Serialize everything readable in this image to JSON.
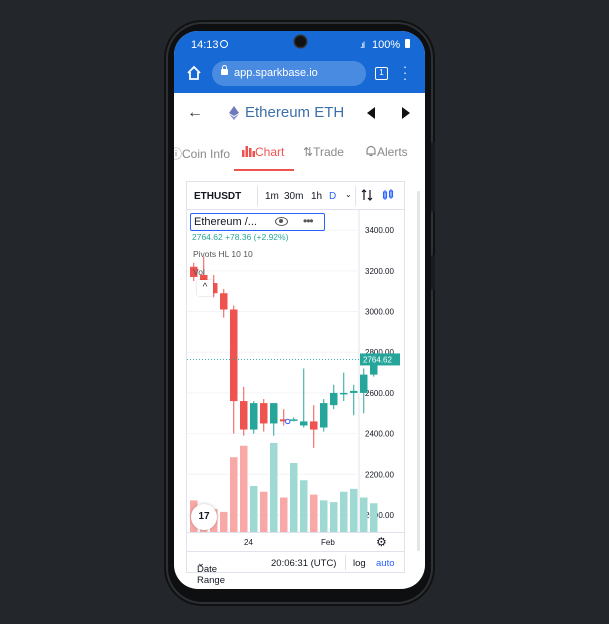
{
  "status": {
    "time": "14:13",
    "battery": "100%"
  },
  "browser": {
    "url": "app.sparkbase.io",
    "tab_count": "1"
  },
  "header": {
    "title": "Ethereum ETH"
  },
  "tabs": [
    {
      "label": "Coin Info",
      "active": false
    },
    {
      "label": "Chart",
      "active": true
    },
    {
      "label": "Trade",
      "active": false
    },
    {
      "label": "Alerts",
      "active": false
    }
  ],
  "chart_toolbar": {
    "symbol": "ETHUSDT",
    "intervals": [
      "1m",
      "30m",
      "1h",
      "D"
    ],
    "selected_interval": "D"
  },
  "legend": {
    "name": "Ethereum /...",
    "price_line": "2764.62 +78.36 (+2.92%)",
    "pivots": "Pivots HL 10 10",
    "volume": "Vol"
  },
  "footer": {
    "date_range": "Date Range",
    "time": "20:06:31 (UTC)",
    "log": "log",
    "auto": "auto"
  },
  "colors": {
    "up": "#26a69a",
    "down": "#ef5350",
    "accent": "#1769d6"
  },
  "chart_data": {
    "type": "candlestick",
    "y_ticks": [
      3400,
      3200,
      3000,
      2800,
      2600,
      2400,
      2200,
      2000
    ],
    "x_labels": [
      "24",
      "Feb"
    ],
    "last_price": "2764.62",
    "candles": [
      {
        "o": 3220,
        "h": 3240,
        "l": 3150,
        "c": 3170
      },
      {
        "o": 3180,
        "h": 3270,
        "l": 3100,
        "c": 3140
      },
      {
        "o": 3140,
        "h": 3180,
        "l": 3070,
        "c": 3090
      },
      {
        "o": 3090,
        "h": 3110,
        "l": 2970,
        "c": 3010
      },
      {
        "o": 3010,
        "h": 3030,
        "l": 2400,
        "c": 2560
      },
      {
        "o": 2560,
        "h": 2630,
        "l": 2390,
        "c": 2420
      },
      {
        "o": 2420,
        "h": 2560,
        "l": 2400,
        "c": 2550
      },
      {
        "o": 2550,
        "h": 2570,
        "l": 2410,
        "c": 2450
      },
      {
        "o": 2450,
        "h": 2520,
        "l": 2390,
        "c": 2550
      },
      {
        "o": 2470,
        "h": 2520,
        "l": 2440,
        "c": 2460
      },
      {
        "o": 2470,
        "h": 2480,
        "l": 2460,
        "c": 2470
      },
      {
        "o": 2440,
        "h": 2720,
        "l": 2430,
        "c": 2460
      },
      {
        "o": 2460,
        "h": 2540,
        "l": 2330,
        "c": 2420
      },
      {
        "o": 2430,
        "h": 2570,
        "l": 2410,
        "c": 2550
      },
      {
        "o": 2540,
        "h": 2640,
        "l": 2520,
        "c": 2600
      },
      {
        "o": 2600,
        "h": 2700,
        "l": 2560,
        "c": 2600
      },
      {
        "o": 2600,
        "h": 2640,
        "l": 2490,
        "c": 2610
      },
      {
        "o": 2600,
        "h": 2720,
        "l": 2500,
        "c": 2690
      },
      {
        "o": 2690,
        "h": 2800,
        "l": 2680,
        "c": 2764.62
      }
    ],
    "volumes": [
      55,
      48,
      40,
      35,
      130,
      150,
      80,
      70,
      155,
      60,
      120,
      90,
      65,
      55,
      52,
      70,
      75,
      60,
      50
    ]
  }
}
